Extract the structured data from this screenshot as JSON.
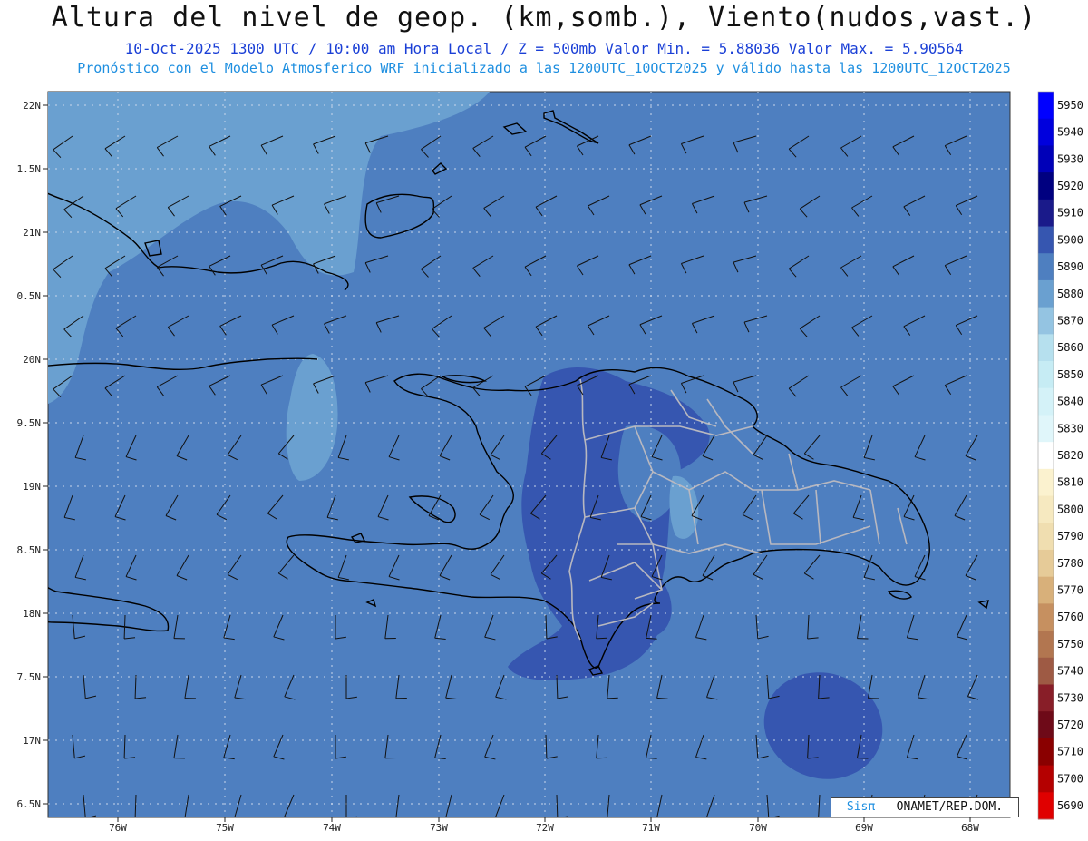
{
  "header": {
    "title": "Altura del nivel de geop. (km,somb.), Viento(nudos,vast.)",
    "line1": "10-Oct-2025  1300 UTC / 10:00 am Hora Local / Z = 500mb   Valor Min. = 5.88036  Valor Max. = 5.90564",
    "line2": "Pronóstico con el Modelo Atmosferico WRF inicializado a las 1200UTC_10OCT2025 y válido hasta las  1200UTC_12OCT2025"
  },
  "axes": {
    "lat_labels": [
      "22N",
      "1.5N",
      "21N",
      "0.5N",
      "20N",
      "9.5N",
      "19N",
      "8.5N",
      "18N",
      "7.5N",
      "17N",
      "6.5N"
    ],
    "lon_labels": [
      "76W",
      "75W",
      "74W",
      "73W",
      "72W",
      "71W",
      "70W",
      "69W",
      "68W"
    ]
  },
  "colorbar": {
    "labels": [
      "5950",
      "5940",
      "5930",
      "5920",
      "5910",
      "5900",
      "5890",
      "5880",
      "5870",
      "5860",
      "5850",
      "5840",
      "5830",
      "5820",
      "5810",
      "5800",
      "5790",
      "5780",
      "5770",
      "5760",
      "5750",
      "5740",
      "5730",
      "5720",
      "5710",
      "5700",
      "5690"
    ],
    "colors": [
      "#0000ff",
      "#0000dd",
      "#0000b8",
      "#000080",
      "#1a1a8a",
      "#3656b0",
      "#4e7fc0",
      "#6aa0d0",
      "#94c4e2",
      "#b6e0ee",
      "#c6ecf4",
      "#d4f2f8",
      "#e0f6fa",
      "#ffffff",
      "#fbf2cf",
      "#f6e9c0",
      "#f0deb0",
      "#e6cb98",
      "#d8b07a",
      "#c69060",
      "#b27650",
      "#9e5a44",
      "#881e28",
      "#6e0a18",
      "#8a0000",
      "#b40000",
      "#e00000"
    ]
  },
  "fill_colors": {
    "sea_level": "#4e7fc0",
    "light": "#6aa0d0",
    "dark": "#3656b0"
  },
  "credit": {
    "brand": "Sisπ",
    "text": "– ONAMET/REP.DOM."
  }
}
